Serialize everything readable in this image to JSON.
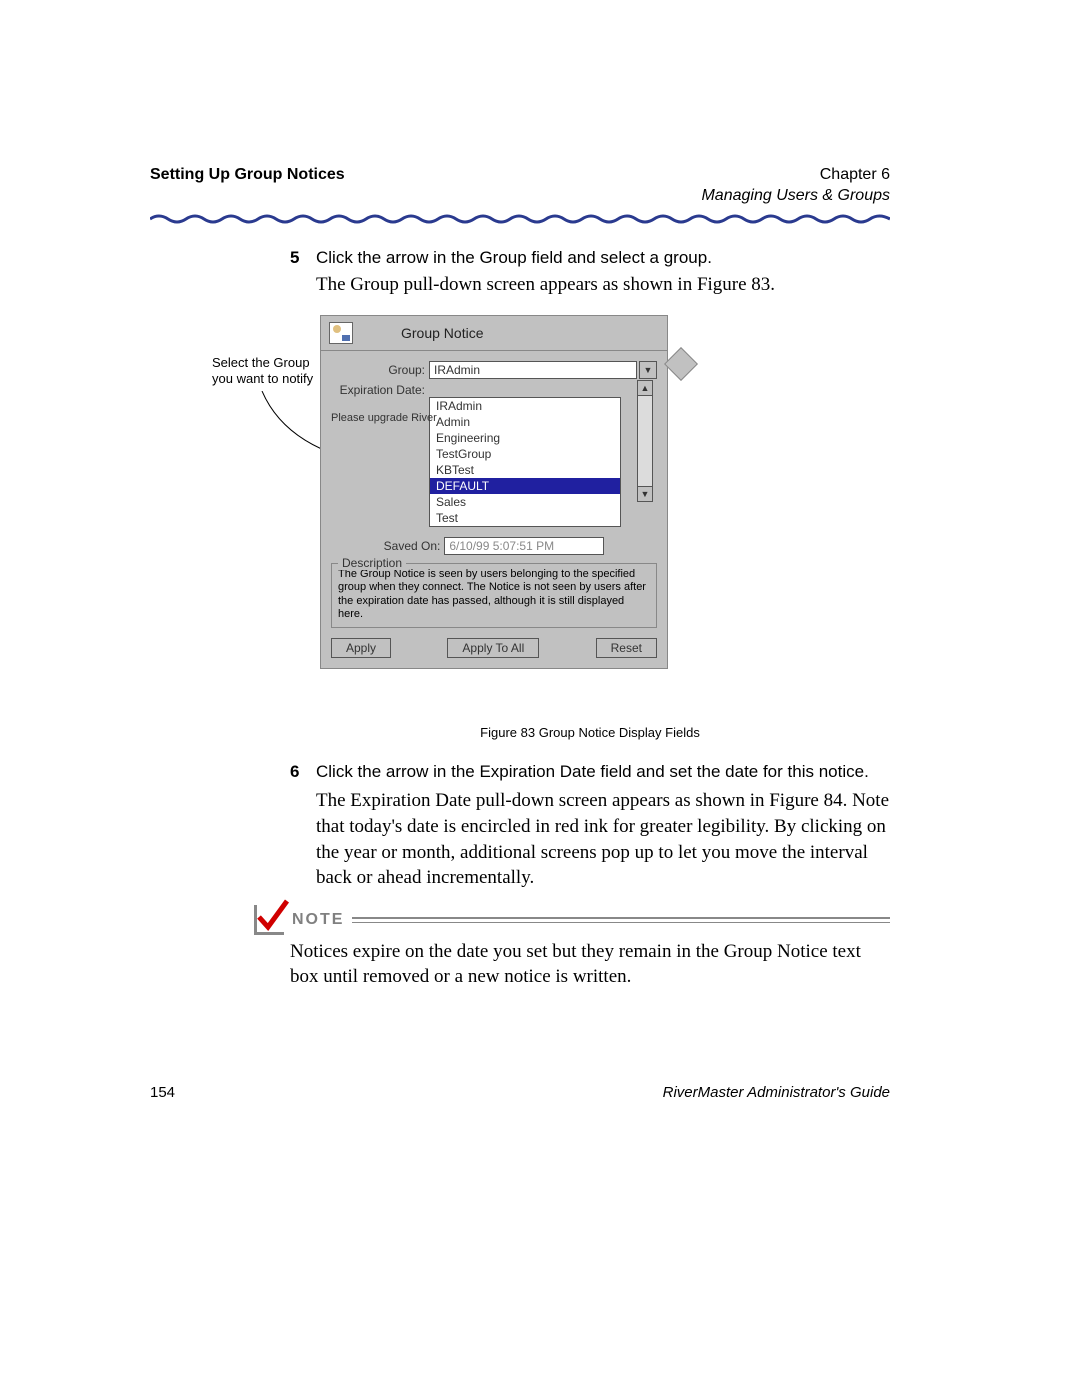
{
  "header": {
    "section": "Setting Up Group Notices",
    "chapter": "Chapter 6",
    "subtitle": "Managing Users & Groups"
  },
  "steps": {
    "s5": {
      "num": "5",
      "instr": "Click the arrow in the Group field and select a group.",
      "detail": "The Group pull-down screen appears as shown in Figure 83."
    },
    "s6": {
      "num": "6",
      "instr": "Click the arrow in the Expiration Date field and set the date for this notice.",
      "detail": "The Expiration Date pull-down screen appears as shown in Figure 84. Note that today's date is encircled in red ink for greater legibility. By clicking on the year or month, additional screens pop up to let you move the interval back or ahead incrementally."
    }
  },
  "callout": "Select the Group you want to notify",
  "dialog": {
    "title": "Group Notice",
    "group_label": "Group:",
    "group_value": "IRAdmin",
    "exp_label": "Expiration Date:",
    "trunc_msg": "Please upgrade River",
    "options": [
      "IRAdmin",
      "Admin",
      "Engineering",
      "TestGroup",
      "KBTest",
      "DEFAULT",
      "Sales",
      "Test"
    ],
    "selected": "DEFAULT",
    "saved_label": "Saved On:",
    "saved_value": "6/10/99 5:07:51 PM",
    "desc_legend": "Description",
    "desc_text": "The Group Notice is seen by users belonging to the specified group when they connect.  The Notice is not seen by users after the expiration date has passed, although it is still displayed here.",
    "buttons": {
      "apply": "Apply",
      "apply_all": "Apply To All",
      "reset": "Reset"
    }
  },
  "figure_caption": "Figure 83   Group Notice Display Fields",
  "note": {
    "label": "NOTE",
    "text": "Notices expire on the date you set but they remain in the Group Notice text box until removed or a new notice is written."
  },
  "footer": {
    "page": "154",
    "doc": "RiverMaster Administrator's Guide"
  }
}
